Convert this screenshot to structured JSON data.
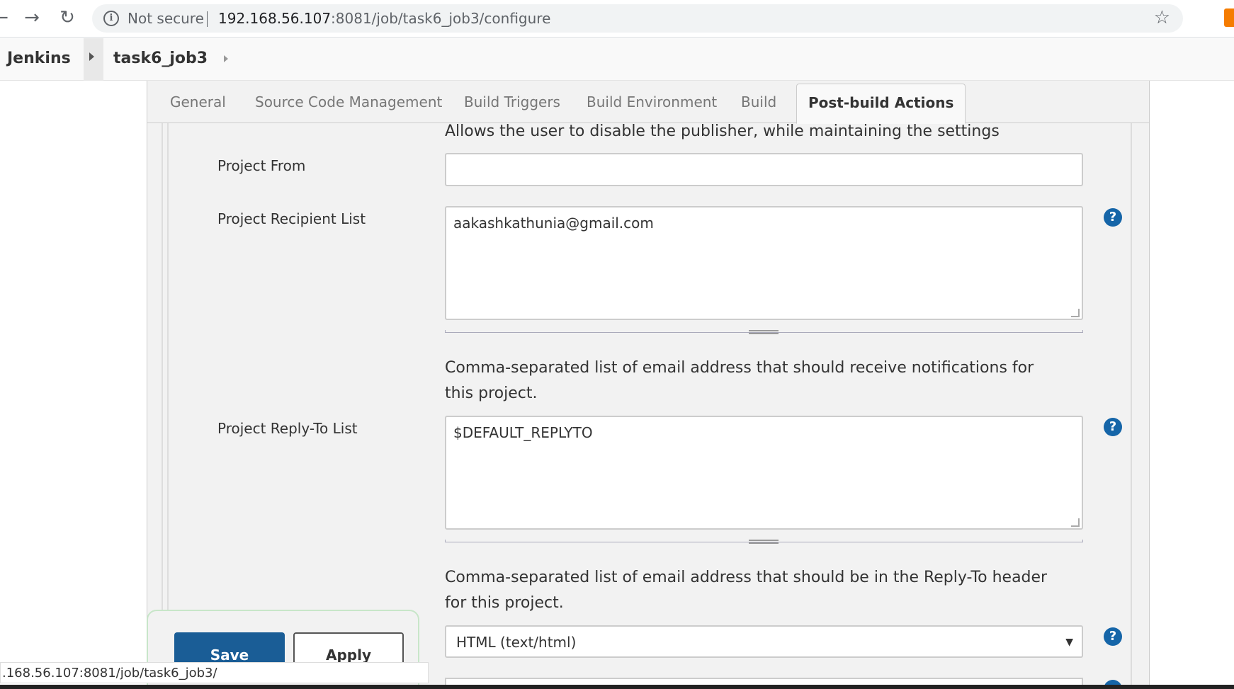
{
  "browser": {
    "security_label": "Not secure",
    "url_host": "192.168.56.107",
    "url_rest": ":8081/job/task6_job3/configure"
  },
  "breadcrumb": {
    "root": "Jenkins",
    "job": "task6_job3"
  },
  "tabs": [
    {
      "label": "General"
    },
    {
      "label": "Source Code Management"
    },
    {
      "label": "Build Triggers"
    },
    {
      "label": "Build Environment"
    },
    {
      "label": "Build"
    },
    {
      "label": "Post-build Actions"
    }
  ],
  "form": {
    "disable_desc": "Allows the user to disable the publisher, while maintaining the settings",
    "project_from": {
      "label": "Project From",
      "value": ""
    },
    "recipient_list": {
      "label": "Project Recipient List",
      "value": "aakashkathunia@gmail.com",
      "help": "Comma-separated list of email address that should receive notifications for this project."
    },
    "reply_to_list": {
      "label": "Project Reply-To List",
      "value": "$DEFAULT_REPLYTO",
      "help": "Comma-separated list of email address that should be in the Reply-To header for this project."
    },
    "content_type": {
      "selected": "HTML (text/html)"
    }
  },
  "buttons": {
    "save": "Save",
    "apply": "Apply"
  },
  "status_bar": ".168.56.107:8081/job/task6_job3/",
  "help_glyph": "?"
}
